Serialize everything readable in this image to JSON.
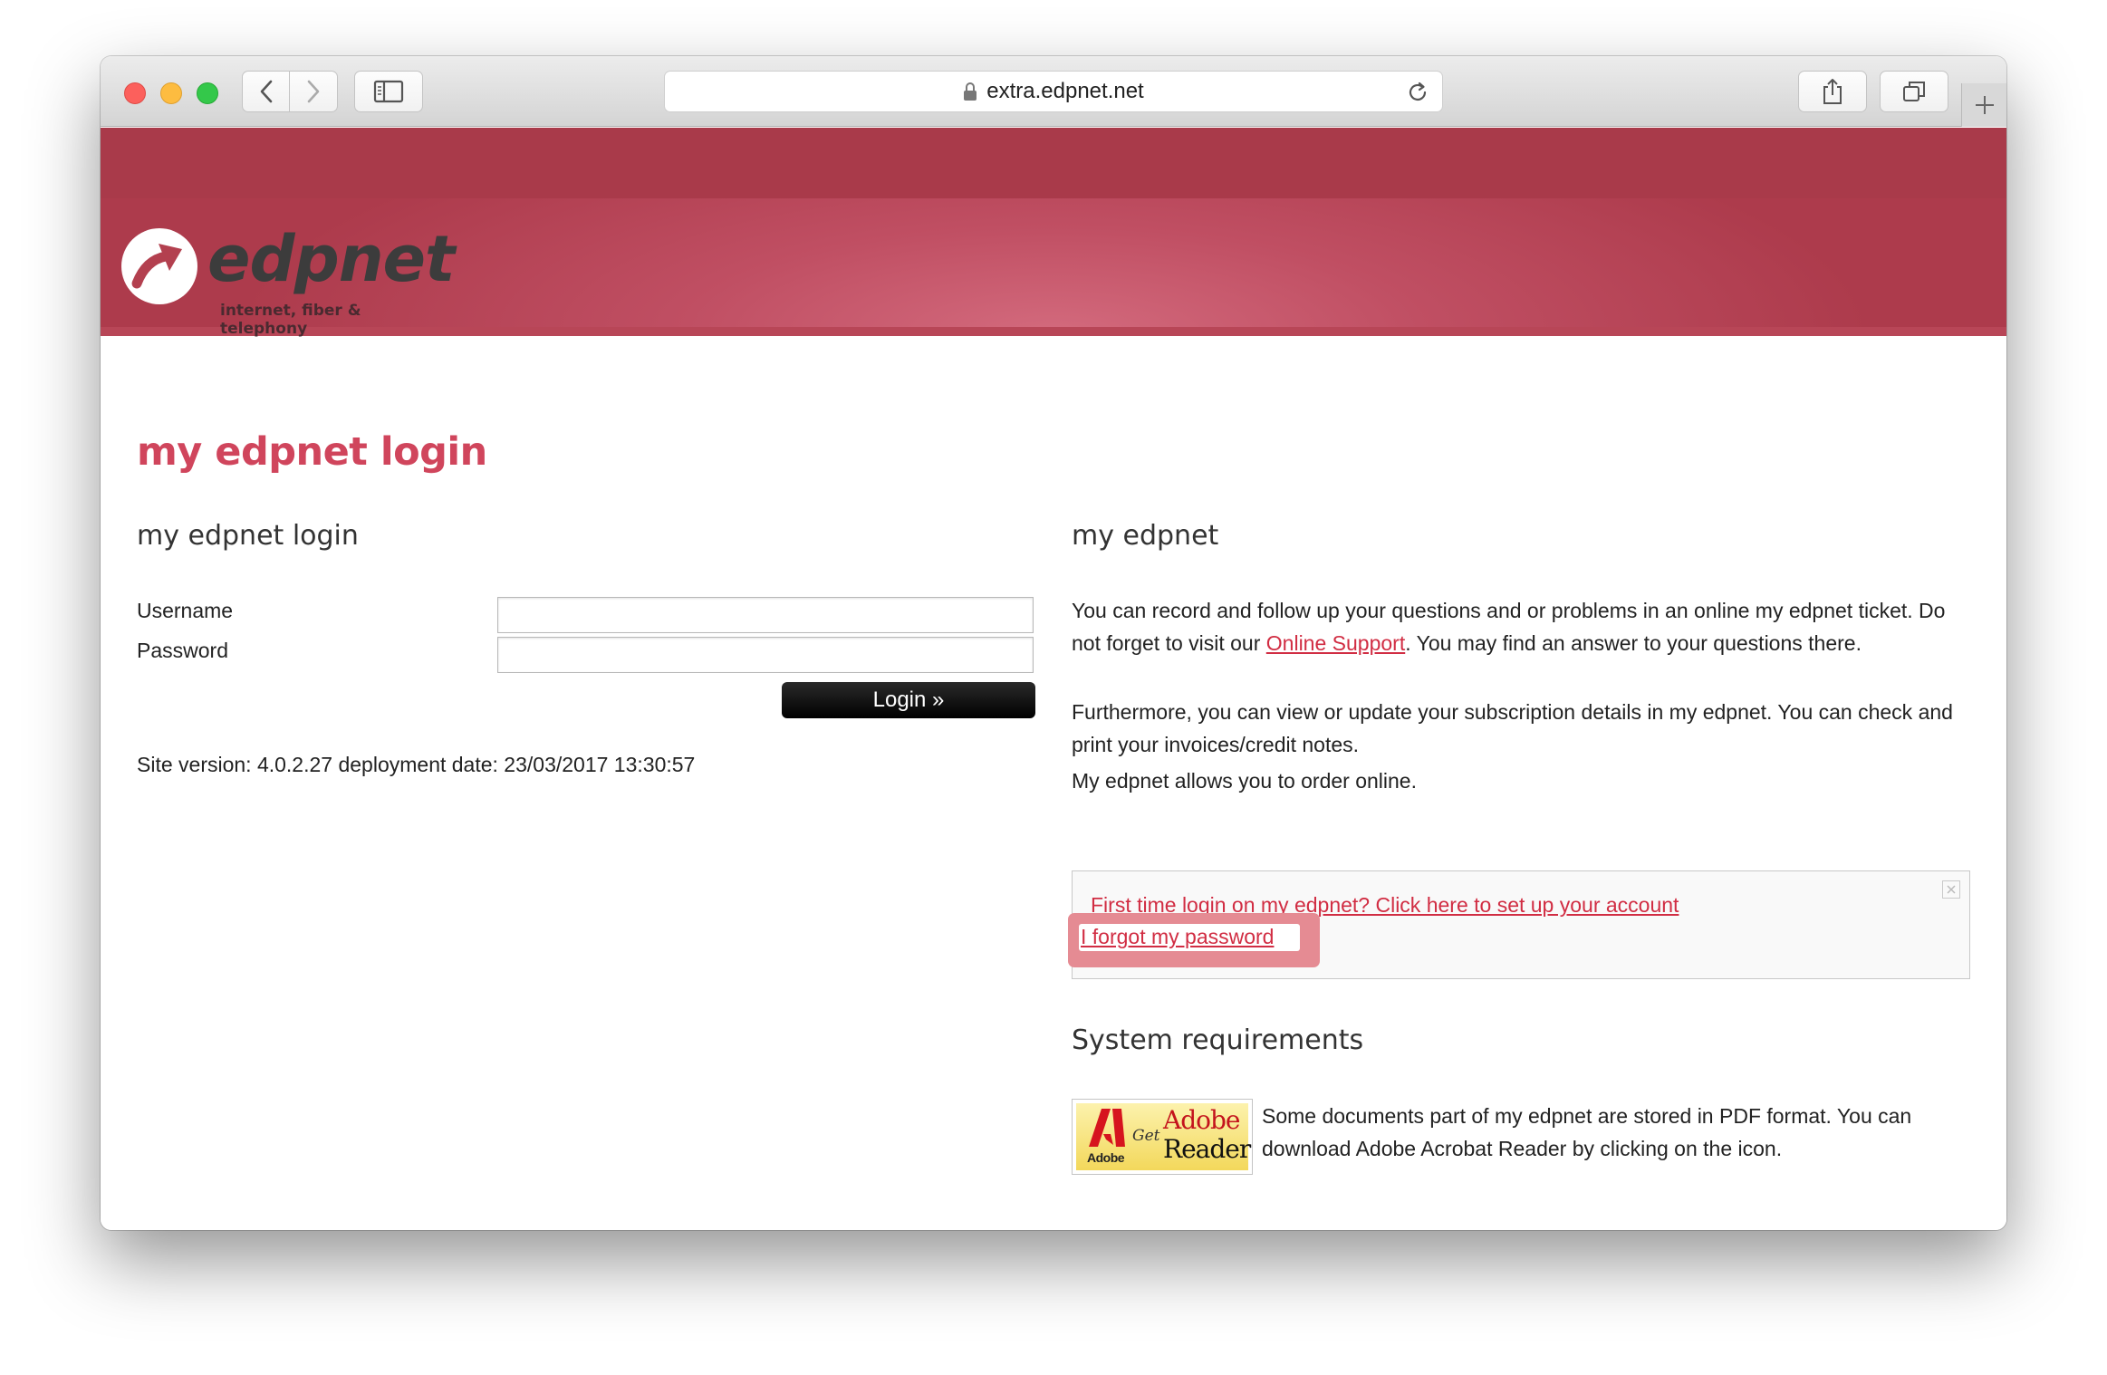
{
  "browser": {
    "url": "extra.edpnet.net"
  },
  "site": {
    "logo_word": "edpnet",
    "logo_tagline": "internet, fiber & telephony"
  },
  "page": {
    "title": "my edpnet login"
  },
  "login": {
    "heading": "my edpnet login",
    "username_label": "Username",
    "password_label": "Password",
    "username_value": "",
    "password_value": "",
    "login_button": "Login »",
    "site_version": "Site version: 4.0.2.27 deployment date: 23/03/2017 13:30:57"
  },
  "info": {
    "heading": "my edpnet",
    "p1_a": "You can record and follow up your questions and or problems in an online my edpnet ticket. Do not forget to visit our ",
    "p1_link": "Online Support",
    "p1_b": ". You may find an answer to your questions there.",
    "p2": "Furthermore, you can view or update your subscription details in my edpnet. You can check and print your invoices/credit notes.",
    "p3": "My edpnet allows you to order online.",
    "first_time_link": "First time login on my edpnet? Click here to set up your account",
    "forgot_link": "I forgot my password"
  },
  "requirements": {
    "heading": "System requirements",
    "text": "Some documents part of my edpnet are stored in PDF format. You can download Adobe Acrobat Reader by clicking on the icon.",
    "badge_get": "Get",
    "badge_brand": "Adobe",
    "badge_product": "Reader",
    "badge_small": "Adobe"
  },
  "colors": {
    "brand_red": "#d0455c",
    "banner": "#a93a4a",
    "link": "#d12d43",
    "highlight": "#e58b93"
  }
}
